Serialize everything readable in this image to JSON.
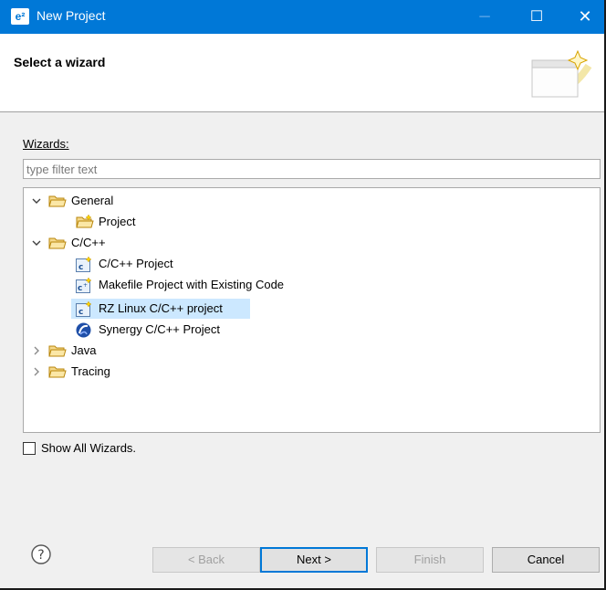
{
  "titlebar": {
    "logo": "e²",
    "title": "New Project",
    "minimize": "─",
    "maximize": "☐",
    "close": "✕"
  },
  "banner": {
    "title": "Select a wizard"
  },
  "wizards": {
    "label": "Wizards:",
    "filter_placeholder": "type filter text"
  },
  "tree": [
    {
      "label": "General",
      "icon": "folder-open-icon",
      "expanded": true
    },
    {
      "label": "Project",
      "icon": "project-wizard-icon"
    },
    {
      "label": "C/C++",
      "icon": "folder-open-icon",
      "expanded": true
    },
    {
      "label": "C/C++ Project",
      "icon": "cpp-project-icon"
    },
    {
      "label": "Makefile Project with Existing Code",
      "icon": "makefile-project-icon"
    },
    {
      "label": "RZ Linux C/C++ project",
      "icon": "cpp-project-icon",
      "selected": true
    },
    {
      "label": "Synergy C/C++ Project",
      "icon": "synergy-icon"
    },
    {
      "label": "Java",
      "icon": "folder-closed-icon",
      "expanded": false
    },
    {
      "label": "Tracing",
      "icon": "folder-closed-icon",
      "expanded": false
    }
  ],
  "show_all": {
    "label": "Show All Wizards.",
    "checked": false
  },
  "buttons": {
    "back": "< Back",
    "next": "Next >",
    "finish": "Finish",
    "cancel": "Cancel"
  },
  "colors": {
    "titlebar": "#0078d7",
    "selection": "#cce8ff",
    "folder": "#e8c05a"
  }
}
